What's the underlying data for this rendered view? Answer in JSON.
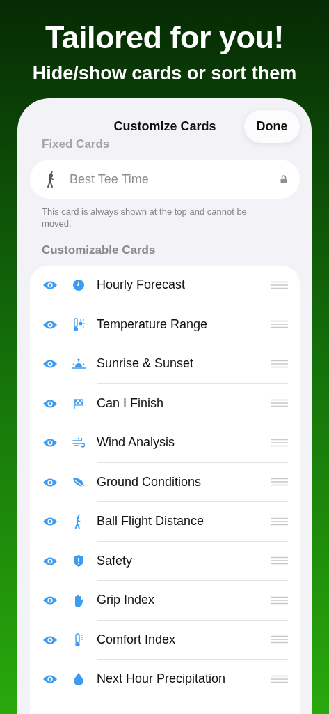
{
  "headline": "Tailored for you!",
  "subheadline": "Hide/show cards or sort them",
  "sheet": {
    "title": "Customize Cards",
    "done_button": "Done"
  },
  "fixed_section": {
    "header": "Fixed Cards",
    "card": {
      "label": "Best Tee Time",
      "locked": true
    },
    "footer": "This card is always shown at the top and cannot be moved."
  },
  "custom_section": {
    "header": "Customizable Cards",
    "cards": [
      {
        "label": "Hourly Forecast",
        "kind": "clock",
        "visible": true
      },
      {
        "label": "Temperature Range",
        "kind": "thermometer-sun",
        "visible": true
      },
      {
        "label": "Sunrise & Sunset",
        "kind": "sunrise",
        "visible": true
      },
      {
        "label": "Can I Finish",
        "kind": "flag",
        "visible": true
      },
      {
        "label": "Wind Analysis",
        "kind": "wind",
        "visible": true
      },
      {
        "label": "Ground Conditions",
        "kind": "leaf",
        "visible": true
      },
      {
        "label": "Ball Flight Distance",
        "kind": "golfer",
        "visible": true
      },
      {
        "label": "Safety",
        "kind": "shield",
        "visible": true
      },
      {
        "label": "Grip Index",
        "kind": "hand",
        "visible": true
      },
      {
        "label": "Comfort Index",
        "kind": "thermometer",
        "visible": true
      },
      {
        "label": "Next Hour Precipitation",
        "kind": "drop",
        "visible": true
      }
    ]
  }
}
